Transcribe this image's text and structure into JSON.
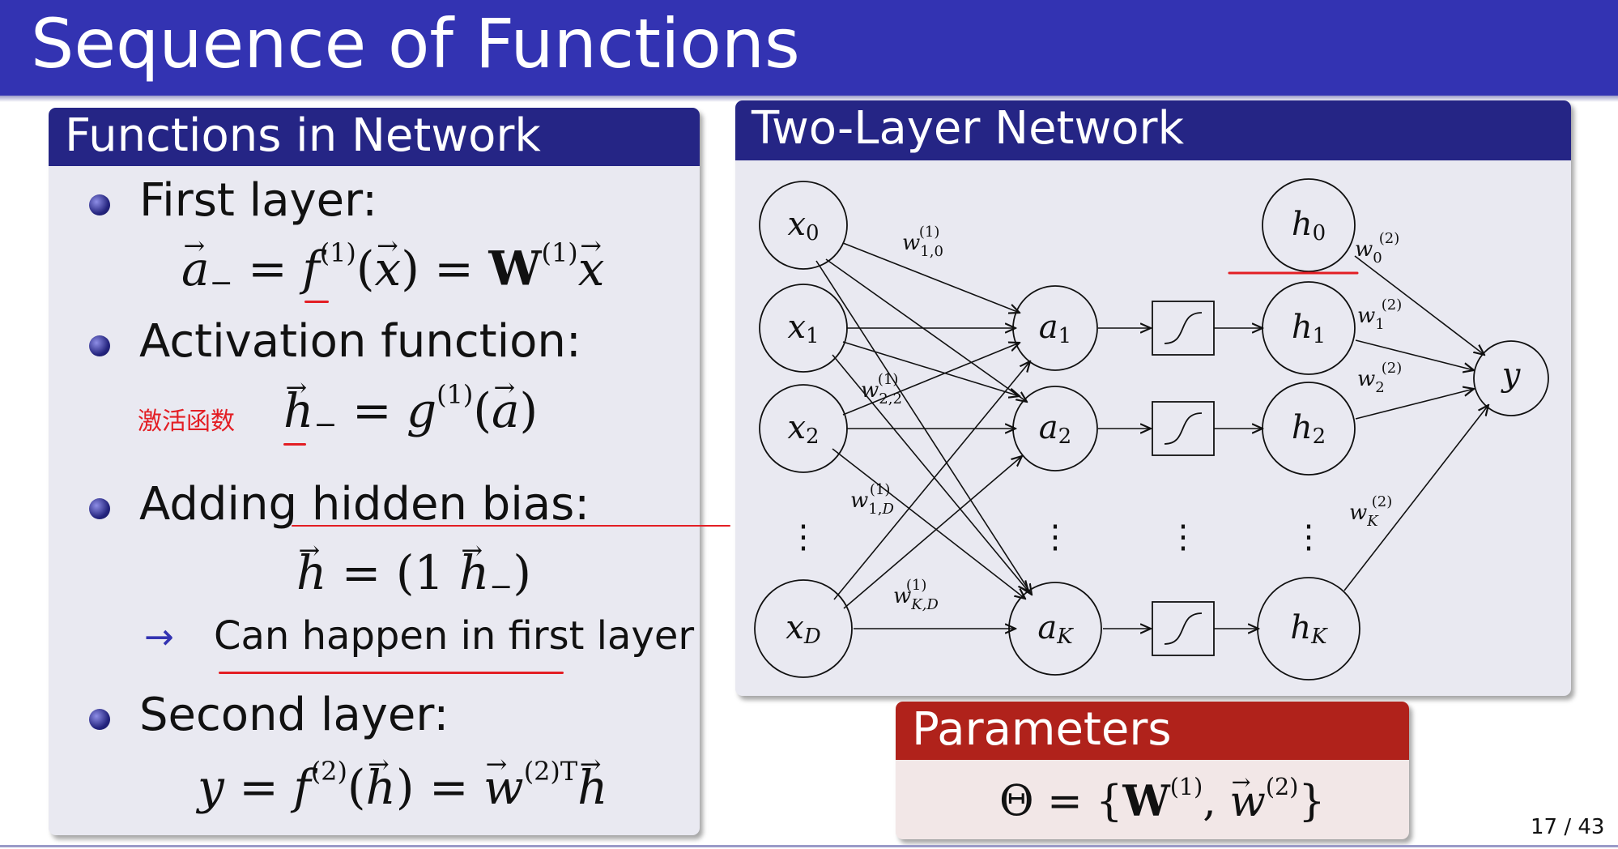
{
  "slide": {
    "title": "Sequence of Functions",
    "page_number": "17 / 43"
  },
  "left_block": {
    "title": "Functions in Network",
    "items": [
      {
        "label": "First layer:"
      },
      {
        "label": "Activation function:",
        "annotation": "激活函数"
      },
      {
        "label": "Adding hidden bias:",
        "sub_item": "Can happen in first layer",
        "arrow": "→"
      },
      {
        "label": "Second layer:"
      }
    ]
  },
  "right_block": {
    "title": "Two-Layer Network",
    "nodes": {
      "inputs": [
        "x0",
        "x1",
        "x2",
        "xD"
      ],
      "activations": [
        "a1",
        "a2",
        "aK"
      ],
      "hidden": [
        "h0",
        "h1",
        "h2",
        "hK"
      ],
      "output": "y"
    }
  },
  "params_block": {
    "title": "Parameters"
  },
  "colors": {
    "title_bar": "#3333b2",
    "block_header": "#252585",
    "block_body": "#e9e9f1",
    "params_header": "#b0221b",
    "params_body": "#f2e7e7",
    "annotation": "#e31e24"
  }
}
